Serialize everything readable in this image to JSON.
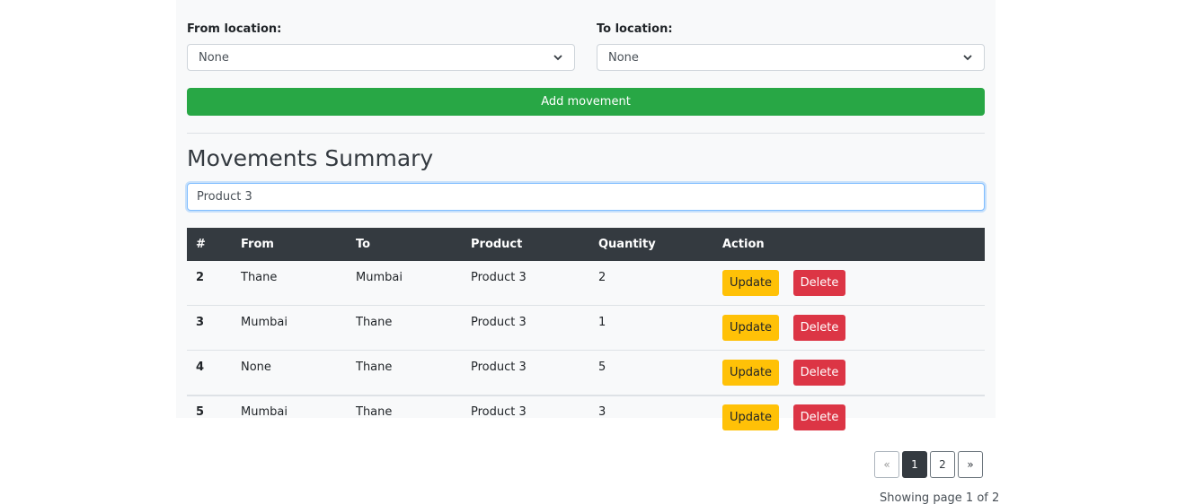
{
  "form": {
    "from_label": "From location:",
    "from_value": "None",
    "to_label": "To location:",
    "to_value": "None",
    "add_button": "Add movement"
  },
  "summary": {
    "heading": "Movements Summary",
    "search_value": "Product 3"
  },
  "table": {
    "headers": [
      "#",
      "From",
      "To",
      "Product",
      "Quantity",
      "Action"
    ],
    "update_label": "Update",
    "delete_label": "Delete",
    "rows": [
      {
        "id": "2",
        "from": "Thane",
        "to": "Mumbai",
        "product": "Product 3",
        "quantity": "2"
      },
      {
        "id": "3",
        "from": "Mumbai",
        "to": "Thane",
        "product": "Product 3",
        "quantity": "1"
      },
      {
        "id": "4",
        "from": "None",
        "to": "Thane",
        "product": "Product 3",
        "quantity": "5"
      },
      {
        "id": "5",
        "from": "Mumbai",
        "to": "Thane",
        "product": "Product 3",
        "quantity": "3"
      }
    ]
  },
  "pagination": {
    "prev": "«",
    "pages": [
      "1",
      "2"
    ],
    "next": "»",
    "current_page": "1",
    "status": "Showing page 1 of 2"
  },
  "colors": {
    "primary_success": "#28a745",
    "update": "#ffc107",
    "delete": "#dc3545",
    "table_header": "#343a40"
  }
}
